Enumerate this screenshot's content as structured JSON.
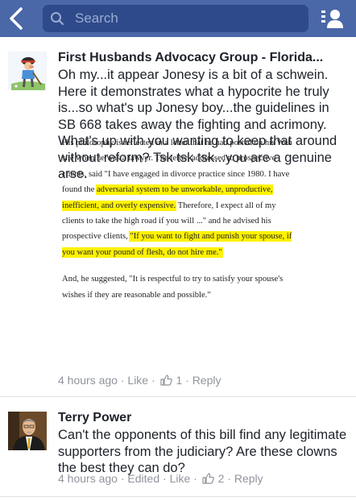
{
  "header": {
    "search_placeholder": "Search"
  },
  "colors": {
    "topbar": "#4a67a8",
    "search_field": "#2f4a8a",
    "highlight": "#fff200",
    "meta_text": "#90949c"
  },
  "comments": [
    {
      "author": "First Husbands Advocacy Group - Florida...",
      "text": "Oh my...it appear Jonesy is a bit of a schwein. Here it demonstrates what a hypocrite he truly is...so what's up Jonesy boy...the guidelines in SB 668 takes away the fighting and acrimony. What's up with you wanting to keep that around without reform? Tsk tsk tsk...you are a genuine arse.",
      "attachment": {
        "seg1": "His philosophy is reflected in a letter that he had posted on his Web site when he was a lawyer. The letter, addressed to prospective clients, said \"I have engaged in divorce practice since 1980. I have found the ",
        "hl1": "adversarial system to be unworkable, unproductive, inefficient, and overly expensive.",
        "seg2": " Therefore, I expect all of my clients to take the high road if you will ...\" and he advised his prospective clients, ",
        "hl2": "\"If you want to fight and punish your spouse, if you want your pound of flesh, do not hire me.\"",
        "para2": "And, he suggested, \"It is respectful to try to satisfy your spouse's wishes if they are reasonable and possible.\""
      },
      "time": "4 hours ago",
      "sep": "·",
      "edited": "",
      "like_label": "Like",
      "like_count": "1",
      "reply_label": "Reply"
    },
    {
      "author": "Terry Power",
      "text": "Can't the opponents of this bill find any legitimate supporters from the judiciary? Are these clowns the best they can do?",
      "time": "4 hours ago",
      "sep": "·",
      "edited": "Edited",
      "like_label": "Like",
      "like_count": "2",
      "reply_label": "Reply"
    }
  ]
}
